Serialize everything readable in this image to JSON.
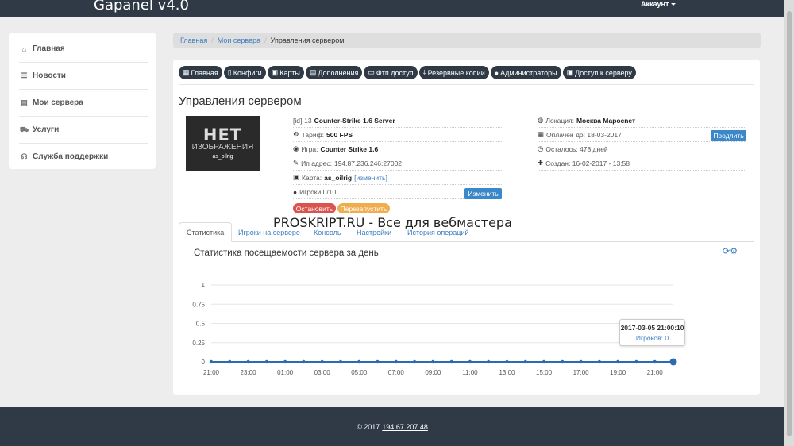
{
  "header": {
    "brand": "Gapanel v4.0",
    "account": "Аккаунт"
  },
  "sidebar": {
    "items": [
      {
        "label": "Главная",
        "icon": "home-icon",
        "glyph": "⌂"
      },
      {
        "label": "Новости",
        "icon": "list-icon",
        "glyph": "☰"
      },
      {
        "label": "Мои сервера",
        "icon": "server-list-icon",
        "glyph": "▤"
      },
      {
        "label": "Услуги",
        "icon": "cart-icon",
        "glyph": "⛟"
      },
      {
        "label": "Служба поддержки",
        "icon": "headset-icon",
        "glyph": "☊"
      }
    ]
  },
  "breadcrumb": {
    "home": "Главная",
    "servers": "Мои сервера",
    "current": "Управления сервером"
  },
  "toolbar": {
    "buttons": [
      {
        "label": "Главная",
        "icon": "grid-icon",
        "glyph": "▦"
      },
      {
        "label": "Конфиги",
        "icon": "file-icon",
        "glyph": "▯"
      },
      {
        "label": "Карты",
        "icon": "image-icon",
        "glyph": "▣"
      },
      {
        "label": "Дополнения",
        "icon": "puzzle-icon",
        "glyph": "▤"
      },
      {
        "label": "Фтп доступ",
        "icon": "folder-icon",
        "glyph": "▭"
      },
      {
        "label": "Резервные копии",
        "icon": "download-icon",
        "glyph": "⤓"
      },
      {
        "label": "Администраторы",
        "icon": "user-icon",
        "glyph": "●"
      },
      {
        "label": "Доступ к серверу",
        "icon": "lock-icon",
        "glyph": "▣"
      }
    ]
  },
  "page": {
    "title": "Управления сервером"
  },
  "server": {
    "image": {
      "line1": "НЕТ",
      "line2": "ИЗОБРАЖЕНИЯ",
      "caption": "as_oilrig"
    },
    "id_label": "[id]-13",
    "name": "Counter-Strike 1.6 Server",
    "tariff_label": "Тариф:",
    "tariff": "500 FPS",
    "game_label": "Игра:",
    "game": "Counter Strike 1.6",
    "ip_label": "Ип адрес:",
    "ip": "194.87.236.246:27002",
    "map_label": "Карта:",
    "map": "as_oilrig",
    "map_change": "[изменить]",
    "players_label": "Игроки 0/10",
    "change_btn": "Изменить",
    "stop_btn": "Остановить",
    "restart_btn": "Перезапустить",
    "location_label": "Локация:",
    "location": "Москва Маросnет",
    "paid_label": "Оплачен до: 18-03-2017",
    "extend_btn": "Продлить",
    "left_label": "Осталось: 478 дней",
    "created_label": "Создан: 16-02-2017 - 13:58"
  },
  "tabs": [
    "Статистика",
    "Игроки на сервере",
    "Консоль",
    "Настройки",
    "История операций"
  ],
  "watermark": "PROSKRIPT.RU - Все для вебмастера",
  "chart_title": "Статистика посещаемости сервера за день",
  "chart_data": {
    "type": "line",
    "title": "Статистика посещаемости сервера за день",
    "y_ticks": [
      "1",
      "0.75",
      "0.5",
      "0.25",
      "0"
    ],
    "ylim": [
      0,
      1
    ],
    "x_tick_labels": [
      "21:00",
      "23:00",
      "01:00",
      "03:00",
      "05:00",
      "07:00",
      "09:00",
      "11:00",
      "13:00",
      "15:00",
      "17:00",
      "19:00",
      "21:00"
    ],
    "points": 26,
    "values": [
      0,
      0,
      0,
      0,
      0,
      0,
      0,
      0,
      0,
      0,
      0,
      0,
      0,
      0,
      0,
      0,
      0,
      0,
      0,
      0,
      0,
      0,
      0,
      0,
      0,
      0
    ],
    "color": "#2b6cb0",
    "grid": true
  },
  "tooltip": {
    "time": "2017-03-05 21:00:10",
    "label": "Игроков: 0"
  },
  "footer": {
    "text": "© 2017",
    "ip": "194.67.207.48"
  }
}
